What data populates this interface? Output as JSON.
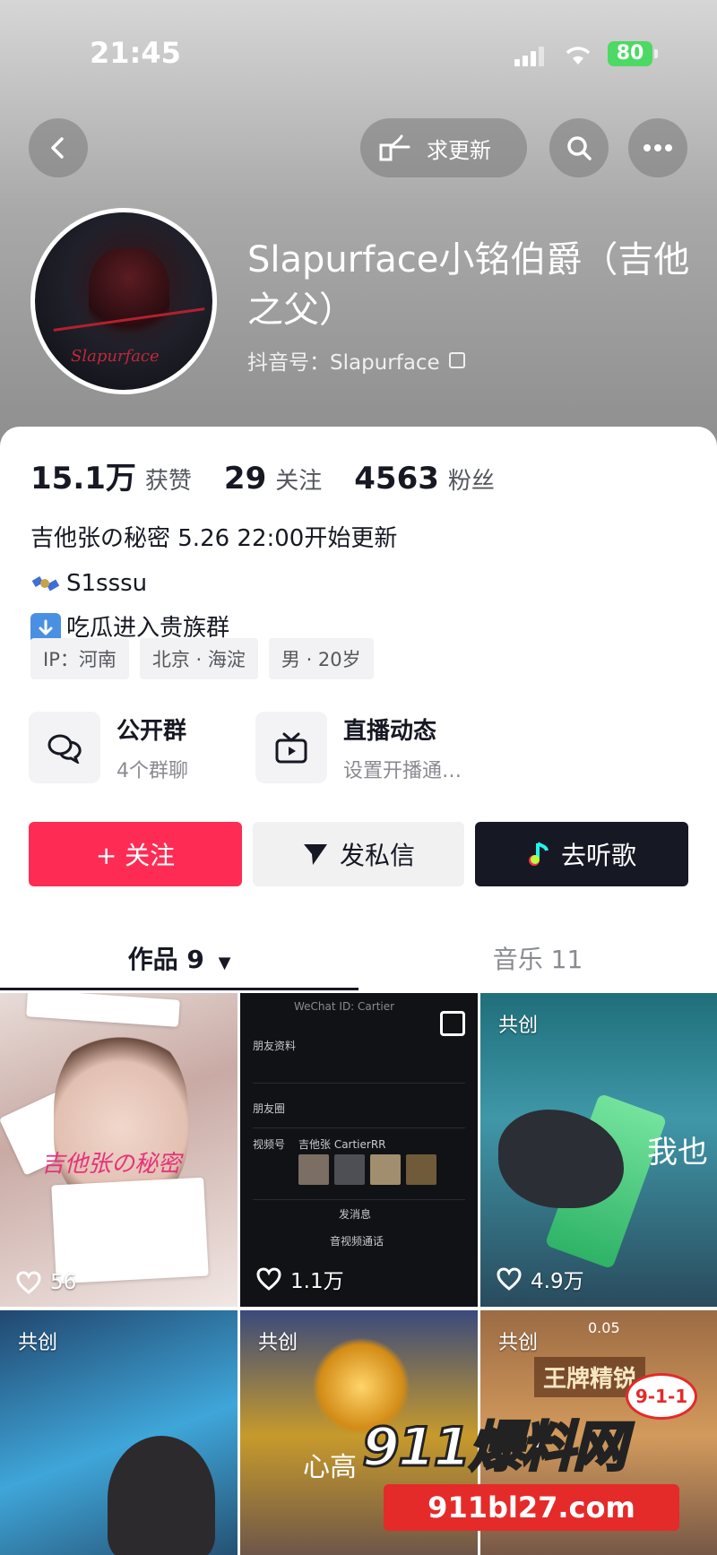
{
  "status_bar": {
    "time": "21:45",
    "battery": "80"
  },
  "header": {
    "update_request_label": "求更新",
    "nickname": "Slapurface小铭伯爵（吉他之父）",
    "douyin_id": "抖音号：Slapurface",
    "avatar_signature": "Slapurface"
  },
  "stats": [
    {
      "value": "15.1万",
      "label": "获赞"
    },
    {
      "value": "29",
      "label": "关注"
    },
    {
      "value": "4563",
      "label": "粉丝"
    }
  ],
  "bio": {
    "line1": "吉他张の秘密 5.26 22:00开始更新",
    "line2": "S1sssu",
    "line3": "吃瓜进入贵族群"
  },
  "tags": [
    "IP：河南",
    "北京 · 海淀",
    "男 · 20岁"
  ],
  "tiles": {
    "group": {
      "title": "公开群",
      "subtitle": "4个群聊"
    },
    "live": {
      "title": "直播动态",
      "subtitle": "设置开播通…"
    }
  },
  "actions": {
    "follow": "+ 关注",
    "message": "发私信",
    "music": "去听歌"
  },
  "tabs": {
    "works": "作品 9",
    "music": "音乐 11"
  },
  "videos": [
    {
      "likes": "56",
      "collab": "",
      "overlay": "吉他张の秘密"
    },
    {
      "likes": "1.1万",
      "collab": "",
      "overlay": "WeChat ID: Cartier",
      "rows": [
        "朋友资料",
        "朋友圈",
        "视频号",
        "发消息",
        "音视频通话"
      ],
      "channel": "吉他张 CartierRR"
    },
    {
      "likes": "4.9万",
      "collab": "共创",
      "overlay": "我也"
    },
    {
      "likes": "",
      "collab": "共创",
      "overlay": ""
    },
    {
      "likes": "",
      "collab": "共创",
      "overlay": "心高"
    },
    {
      "likes": "",
      "collab": "共创",
      "overlay": "王牌精锐",
      "score": "0.05"
    }
  ],
  "watermark": {
    "main": "911爆料网",
    "url": "911bl27.com",
    "badge": "9-1-1"
  },
  "colors": {
    "follow": "#fe2c55",
    "music_button": "#161823",
    "battery": "#4cd964"
  }
}
